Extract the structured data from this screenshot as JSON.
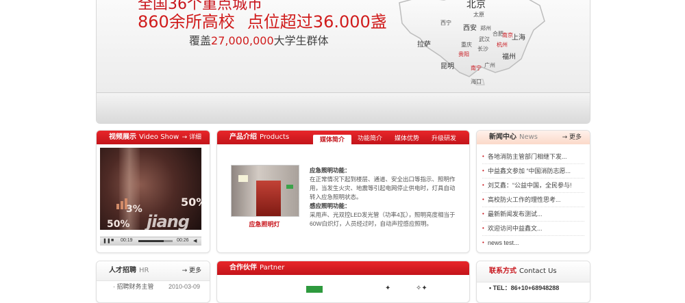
{
  "banner": {
    "top_line_fragment": "全国36个重点城市",
    "headline_left": "860余所高校",
    "headline_right": "点位超过36.000盏",
    "subline_prefix": "覆盖",
    "subline_number": "27,000,000",
    "subline_suffix": "大学生群体",
    "map_cities": [
      "北京",
      "太原",
      "西宁",
      "西安",
      "郑州",
      "合肥",
      "南京",
      "上海",
      "拉萨",
      "武汉",
      "重庆",
      "长沙",
      "杭州",
      "贵阳",
      "福州",
      "昆明",
      "南宁",
      "广州",
      "海口"
    ]
  },
  "video_panel": {
    "title": "视频展示",
    "title_en": "Video Show",
    "more": "→ 详细",
    "overlay_pct_1": "3%",
    "overlay_pct_2": "50%",
    "overlay_pct_3": "50%",
    "overlay_brand": "jiang",
    "time_elapsed": "00:19",
    "time_total": "00:26",
    "progress": 0.73
  },
  "product_panel": {
    "title": "产品介绍",
    "title_en": "Products",
    "tabs": [
      "媒体简介",
      "功能简介",
      "媒体优势",
      "升级研发"
    ],
    "active_tab_index": 0,
    "image_caption": "应急照明灯",
    "section1_title": "应急照明功能：",
    "section1_body": "在正常情况下起到楼层、通道、安全出口等指示、照明作用，当发生火灾、地震等引起电网停止供电时，灯具自动转入应急照明状态。",
    "section2_title": "感应照明功能：",
    "section2_body": "采用声、光双控LED发光管（功率4瓦），照明亮度相当于60W白炽灯，人员经过时，自动声控感应照明。"
  },
  "news_panel": {
    "title": "新闻中心",
    "title_en": "News",
    "more": "→ 更多",
    "items": [
      "各地消防主管部门相继下发...",
      "中益鑫文参加 “中国消防志愿...",
      "刘艾鑫：“公益中国，全民参与!",
      "高校防火工作的理性思考...",
      "最新新闻发布测试...",
      "欢迎访问中益鑫文...",
      "news test..."
    ]
  },
  "hr_panel": {
    "title": "人才招聘",
    "title_en": "HR",
    "more": "→ 更多",
    "rows": [
      {
        "text": "· 招聘财务主管",
        "date": "2010-03-09"
      }
    ]
  },
  "partner_panel": {
    "title": "合作伙伴",
    "title_en": "Partner"
  },
  "contact_panel": {
    "title": "联系方式",
    "title_en": "Contact Us",
    "tel": "• TEL：86+10+68948288"
  }
}
